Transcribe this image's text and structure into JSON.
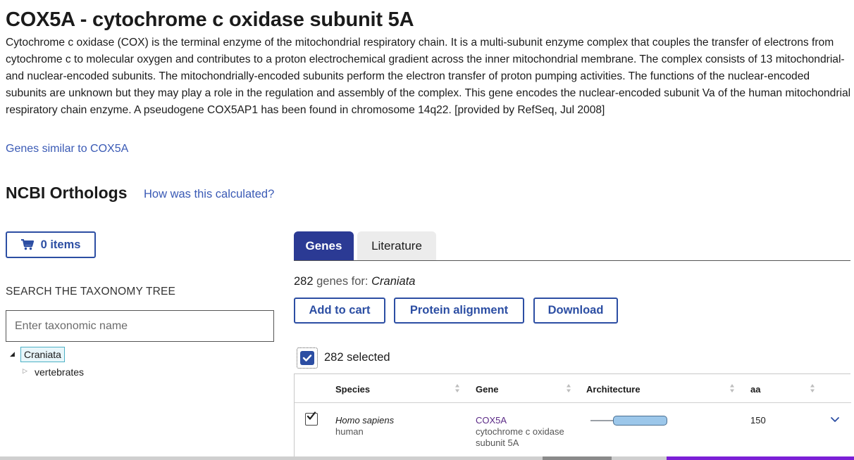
{
  "gene": {
    "title": "COX5A - cytochrome c oxidase subunit 5A",
    "summary": "Cytochrome c oxidase (COX) is the terminal enzyme of the mitochondrial respiratory chain. It is a multi-subunit enzyme complex that couples the transfer of electrons from cytochrome c to molecular oxygen and contributes to a proton electrochemical gradient across the inner mitochondrial membrane. The complex consists of 13 mitochondrial- and nuclear-encoded subunits. The mitochondrially-encoded subunits perform the electron transfer of proton pumping activities. The functions of the nuclear-encoded subunits are unknown but they may play a role in the regulation and assembly of the complex. This gene encodes the nuclear-encoded subunit Va of the human mitochondrial respiratory chain enzyme. A pseudogene COX5AP1 has been found in chromosome 14q22. [provided by RefSeq, Jul 2008]",
    "similar_link": "Genes similar to COX5A"
  },
  "orthologs": {
    "heading": "NCBI Orthologs",
    "calc_link": "How was this calculated?"
  },
  "cart": {
    "label": "0 items",
    "icon": "cart-icon"
  },
  "taxonomy": {
    "heading": "SEARCH THE TAXONOMY TREE",
    "input_placeholder": "Enter taxonomic name",
    "input_value": "",
    "tree": {
      "root": "Craniata",
      "children": [
        "vertebrates"
      ]
    }
  },
  "tabs": [
    {
      "label": "Genes",
      "active": true
    },
    {
      "label": "Literature",
      "active": false
    }
  ],
  "results": {
    "count": "282",
    "count_text": "genes for:",
    "taxon": "Craniata",
    "buttons": {
      "add_to_cart": "Add to cart",
      "protein_alignment": "Protein alignment",
      "download": "Download"
    },
    "selected_text": "282 selected"
  },
  "table": {
    "columns": [
      "Species",
      "Gene",
      "Architecture",
      "aa"
    ],
    "rows": [
      {
        "species": "Homo sapiens",
        "common_name": "human",
        "gene_symbol": "COX5A",
        "gene_desc": "cytochrome c oxidase subunit 5A",
        "aa": "150",
        "checked": true
      }
    ]
  },
  "colors": {
    "primary": "#2c4ea3",
    "tab_active": "#2b3a94",
    "link": "#3a5ab5",
    "gene_link": "#5b2a86",
    "domain_fill": "#9cc7ea"
  }
}
